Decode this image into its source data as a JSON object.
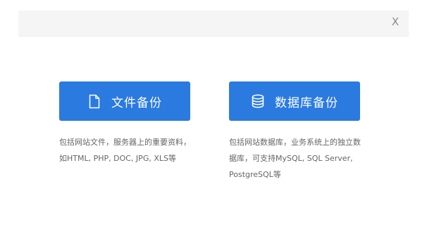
{
  "close_label": "X",
  "file_backup": {
    "button_label": "文件备份",
    "icon": "document-icon",
    "description_lines": [
      "包括网站文件，服务器上的重要资料，",
      "如HTML, PHP, DOC, JPG, XLS等"
    ]
  },
  "db_backup": {
    "button_label": "数据库备份",
    "icon": "database-icon",
    "description_lines": [
      "包括网站数据库，业务系统上的独立数",
      "据库，可支持MySQL, SQL Server,",
      "PostgreSQL等"
    ]
  },
  "colors": {
    "accent": "#2b7ae0",
    "header_bg": "#f5f5f5",
    "desc_text": "#666666"
  }
}
